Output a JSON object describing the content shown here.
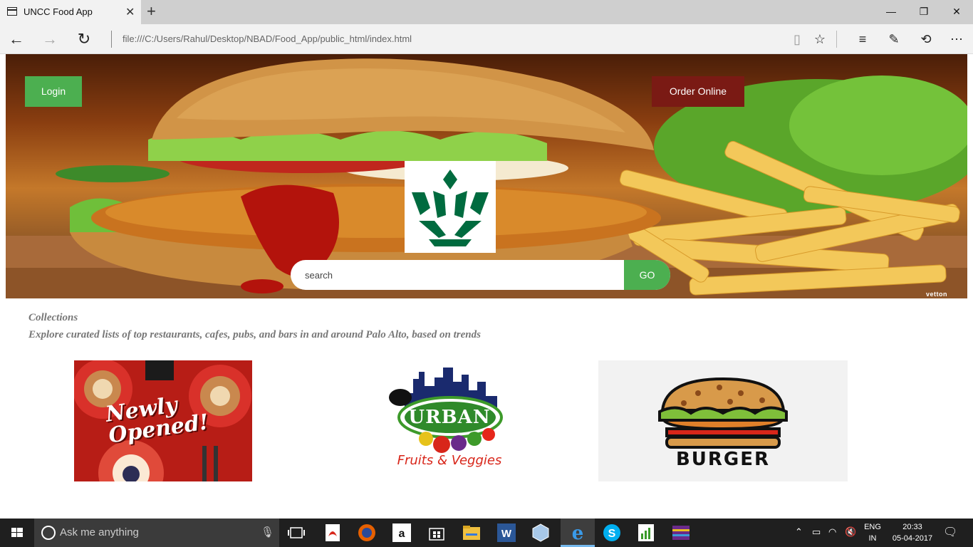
{
  "browser": {
    "tab_title": "UNCC Food App",
    "address": "file:///C:/Users/Rahul/Desktop/NBAD/Food_App/public_html/index.html"
  },
  "header": {
    "login_label": "Login",
    "order_label": "Order Online",
    "search_placeholder": "search",
    "go_label": "GO",
    "watermark": "vetton"
  },
  "collections": {
    "title": "Collections",
    "subtitle": "Explore curated lists of top restaurants, cafes, pubs, and bars in and around Palo Alto, based on trends",
    "cards": [
      {
        "label_line1": "Newly",
        "label_line2": "Opened!"
      },
      {
        "label_top": "URBAN",
        "label_bottom": "Fruits & Veggies"
      },
      {
        "label": "BURGER"
      }
    ]
  },
  "taskbar": {
    "search_placeholder": "Ask me anything",
    "lang_line1": "ENG",
    "lang_line2": "IN",
    "time": "20:33",
    "date": "05-04-2017"
  },
  "colors": {
    "accent_green": "#4caf50",
    "order_red": "#7a1a14",
    "logo_green": "#006b3f"
  }
}
